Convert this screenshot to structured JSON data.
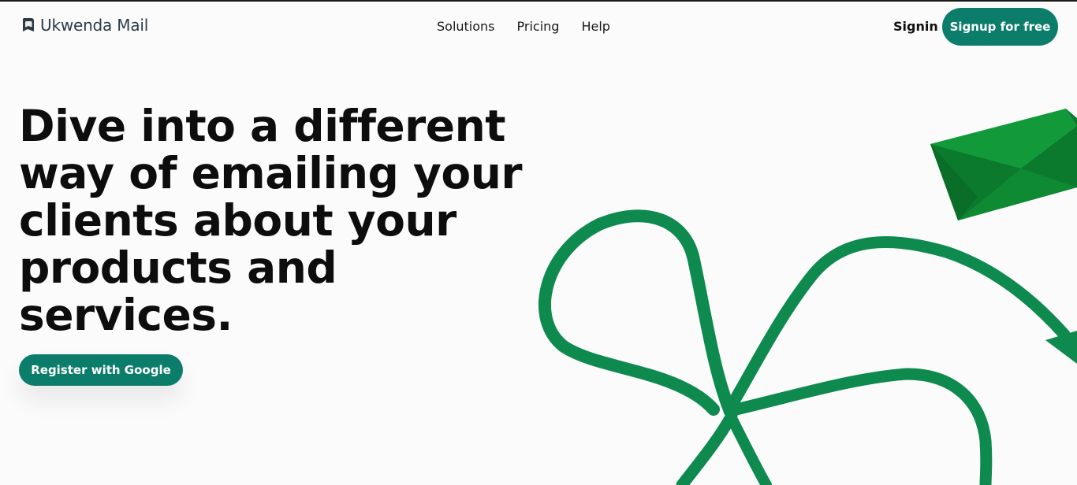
{
  "brand": {
    "name": "Ukwenda Mail",
    "logo_icon": "mail-tag-icon"
  },
  "nav": {
    "items": [
      {
        "label": "Solutions"
      },
      {
        "label": "Pricing"
      },
      {
        "label": "Help"
      }
    ]
  },
  "auth": {
    "signin_label": "Signin",
    "signup_label": "Signup for free"
  },
  "hero": {
    "title": "Dive into a different way of emailing your clients about your products and services.",
    "cta_label": "Register with Google"
  },
  "colors": {
    "accent": "#0c7d6b",
    "ribbon": "#0f8a4f",
    "envelope_dark": "#0b7a2c",
    "envelope_light": "#12a03c"
  }
}
